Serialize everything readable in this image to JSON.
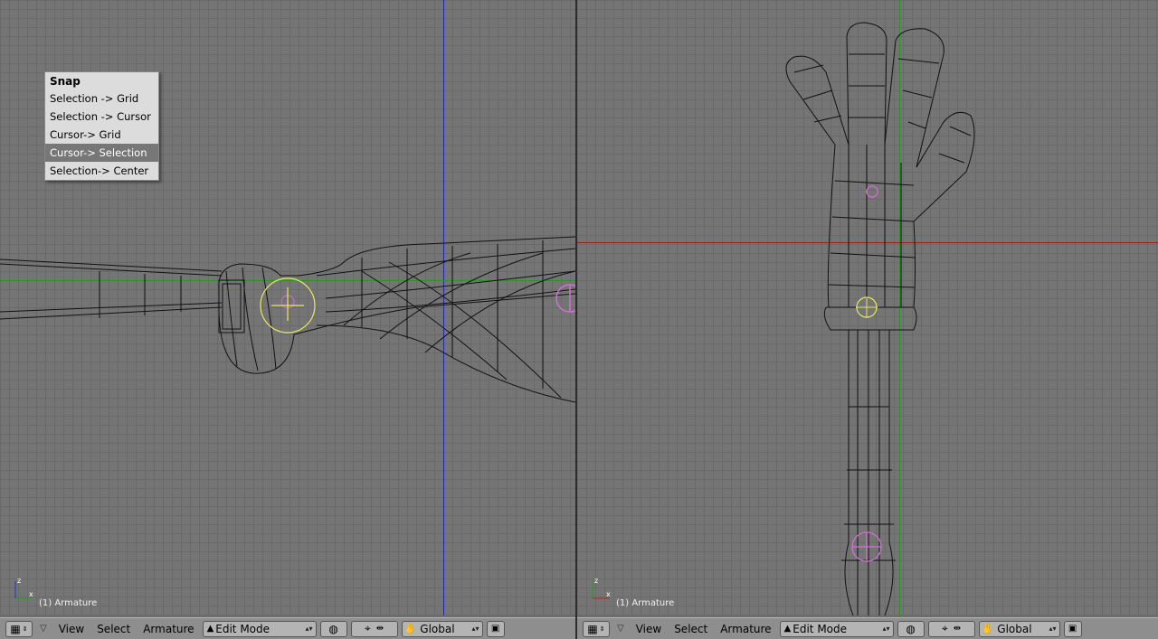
{
  "left_view": {
    "status": "(1) Armature",
    "axis_labels": {
      "z": "z",
      "x": "x"
    }
  },
  "right_view": {
    "status": "(1) Armature",
    "axis_labels": {
      "z": "z",
      "x": "x"
    }
  },
  "snap_menu": {
    "title": "Snap",
    "items": [
      "Selection -> Grid",
      "Selection -> Cursor",
      "Cursor-> Grid",
      "Cursor-> Selection",
      "Selection-> Center"
    ],
    "highlighted": "Cursor-> Selection"
  },
  "header": {
    "view_label": "View",
    "select_label": "Select",
    "armature_label": "Armature",
    "mode": "Edit Mode",
    "orientation": "Global"
  },
  "colors": {
    "grid_background": "#757575",
    "header": "#8e8e8e",
    "menu_highlight": "#777777",
    "x_axis": "#9a2020",
    "green_axis": "#2f8f2f",
    "blue_axis": "#2020b0",
    "cursor_ring": "#e8e860",
    "bone_joint": "#d070d0"
  }
}
